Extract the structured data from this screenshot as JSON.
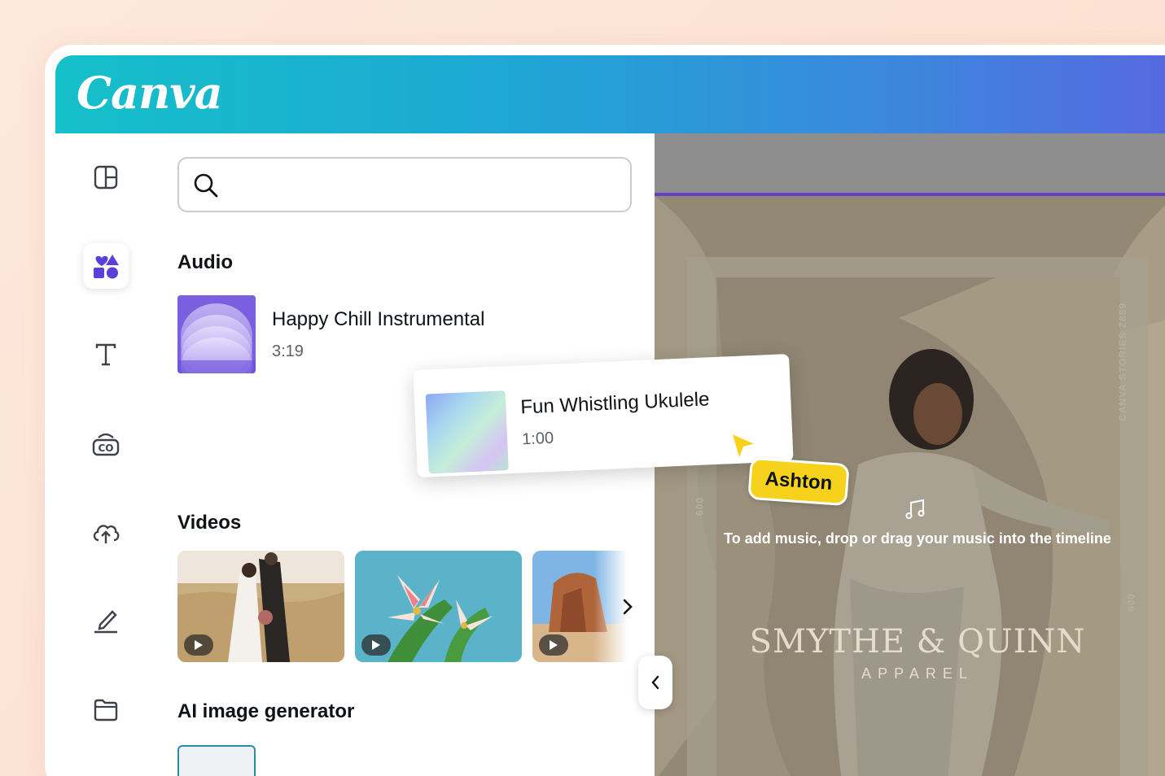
{
  "app": {
    "logo": "Canva"
  },
  "search": {
    "value": "",
    "placeholder": ""
  },
  "sections": {
    "audio": "Audio",
    "videos": "Videos",
    "ai": "AI image generator"
  },
  "audio_items": [
    {
      "title": "Happy Chill Instrumental",
      "duration": "3:19"
    }
  ],
  "drag_item": {
    "title": "Fun Whistling Ukulele",
    "duration": "1:00"
  },
  "collaborator": {
    "name": "Ashton",
    "color": "#f7d21c"
  },
  "canvas": {
    "drop_hint": "To add music, drop or drag your music into the timeline",
    "brand_name": "SMYTHE & QUINN",
    "brand_sub": "APPAREL",
    "side_label_right": "CANVA STORIES Z889",
    "side_label_left": "009",
    "side_label_right2": "009"
  },
  "colors": {
    "accent": "#7d2ae8",
    "topbar_start": "#15c0c9",
    "topbar_end": "#5867e0"
  }
}
